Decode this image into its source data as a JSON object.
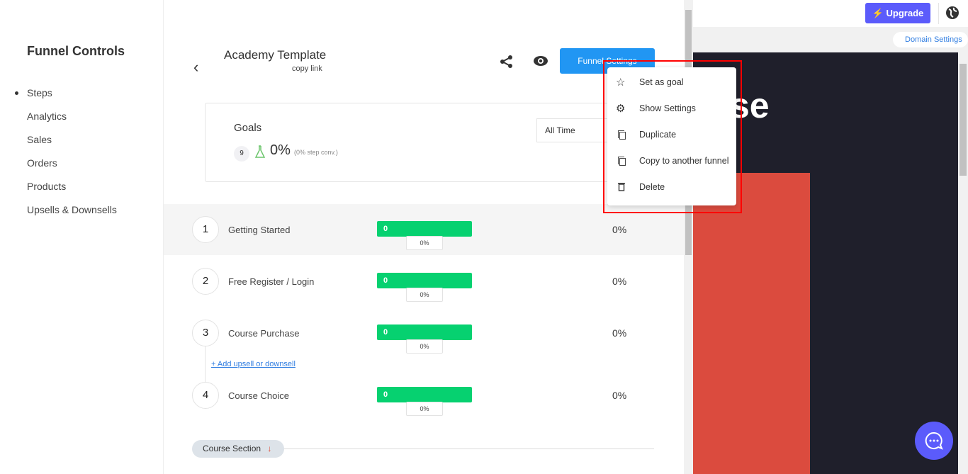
{
  "sidebar": {
    "title": "Funnel Controls",
    "items": [
      {
        "label": "Steps",
        "active": true
      },
      {
        "label": "Analytics"
      },
      {
        "label": "Sales"
      },
      {
        "label": "Orders"
      },
      {
        "label": "Products"
      },
      {
        "label": "Upsells & Downsells"
      }
    ]
  },
  "header": {
    "title": "Academy Template",
    "copy_link": "copy link",
    "funnel_settings": "Funnel Settings",
    "icons": [
      "back-chevron-icon",
      "share-icon",
      "eye-icon"
    ]
  },
  "goals": {
    "title": "Goals",
    "count": "9",
    "percent": "0%",
    "step_conv": "(0% step conv.)",
    "range": "All Time"
  },
  "steps": [
    {
      "num": "1",
      "name": "Getting Started",
      "count": "0",
      "bar_pct": "0%",
      "rate": "0%"
    },
    {
      "num": "2",
      "name": "Free Register / Login",
      "count": "0",
      "bar_pct": "0%",
      "rate": "0%"
    },
    {
      "num": "3",
      "name": "Course Purchase",
      "count": "0",
      "bar_pct": "0%",
      "rate": "0%"
    },
    {
      "num": "4",
      "name": "Course Choice",
      "count": "0",
      "bar_pct": "0%",
      "rate": "0%"
    }
  ],
  "add_upsell": "+ Add upsell or downsell",
  "section": {
    "label": "Course Section",
    "arrow": "↓"
  },
  "topbar": {
    "upgrade": "Upgrade",
    "domain_settings": "Domain Settings"
  },
  "preview": {
    "heading_fragment": "se"
  },
  "menu": {
    "items": [
      {
        "label": "Set as goal",
        "icon": "star-icon"
      },
      {
        "label": "Show Settings",
        "icon": "gear-icon"
      },
      {
        "label": "Duplicate",
        "icon": "copy-icon"
      },
      {
        "label": "Copy to another funnel",
        "icon": "copy-icon"
      },
      {
        "label": "Delete",
        "icon": "trash-icon"
      }
    ]
  },
  "colors": {
    "primary": "#2196f3",
    "upgrade": "#5b5bfb",
    "bar": "#06d170",
    "highlight": "#ff0000"
  }
}
